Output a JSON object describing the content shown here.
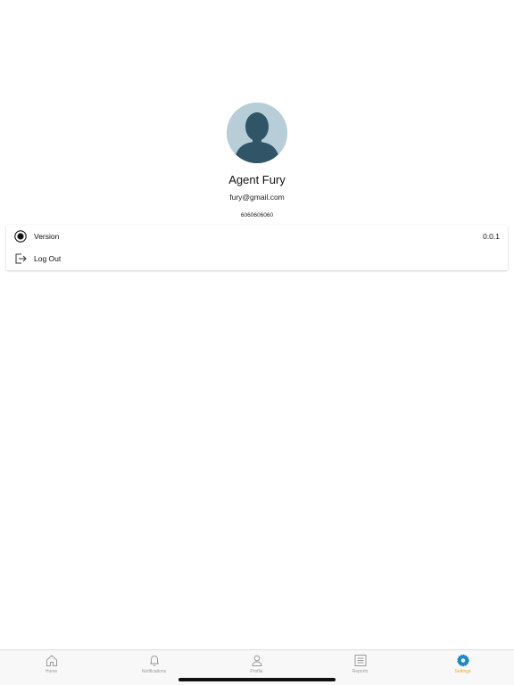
{
  "profile": {
    "name": "Agent Fury",
    "email": "fury@gmail.com",
    "phone": "6060606060"
  },
  "settings": {
    "items": [
      {
        "label": "Version",
        "value": "0.0.1",
        "icon": "radio-icon"
      },
      {
        "label": "Log Out",
        "icon": "logout-icon"
      }
    ]
  },
  "tabbar": {
    "active": "Settings",
    "accent": "#f0a81a",
    "tabs": [
      {
        "label": "Home",
        "icon": "home-icon"
      },
      {
        "label": "Notifications",
        "icon": "bell-icon"
      },
      {
        "label": "Profile",
        "icon": "person-icon"
      },
      {
        "label": "Reports",
        "icon": "list-icon"
      },
      {
        "label": "Settings",
        "icon": "gear-icon"
      }
    ]
  }
}
